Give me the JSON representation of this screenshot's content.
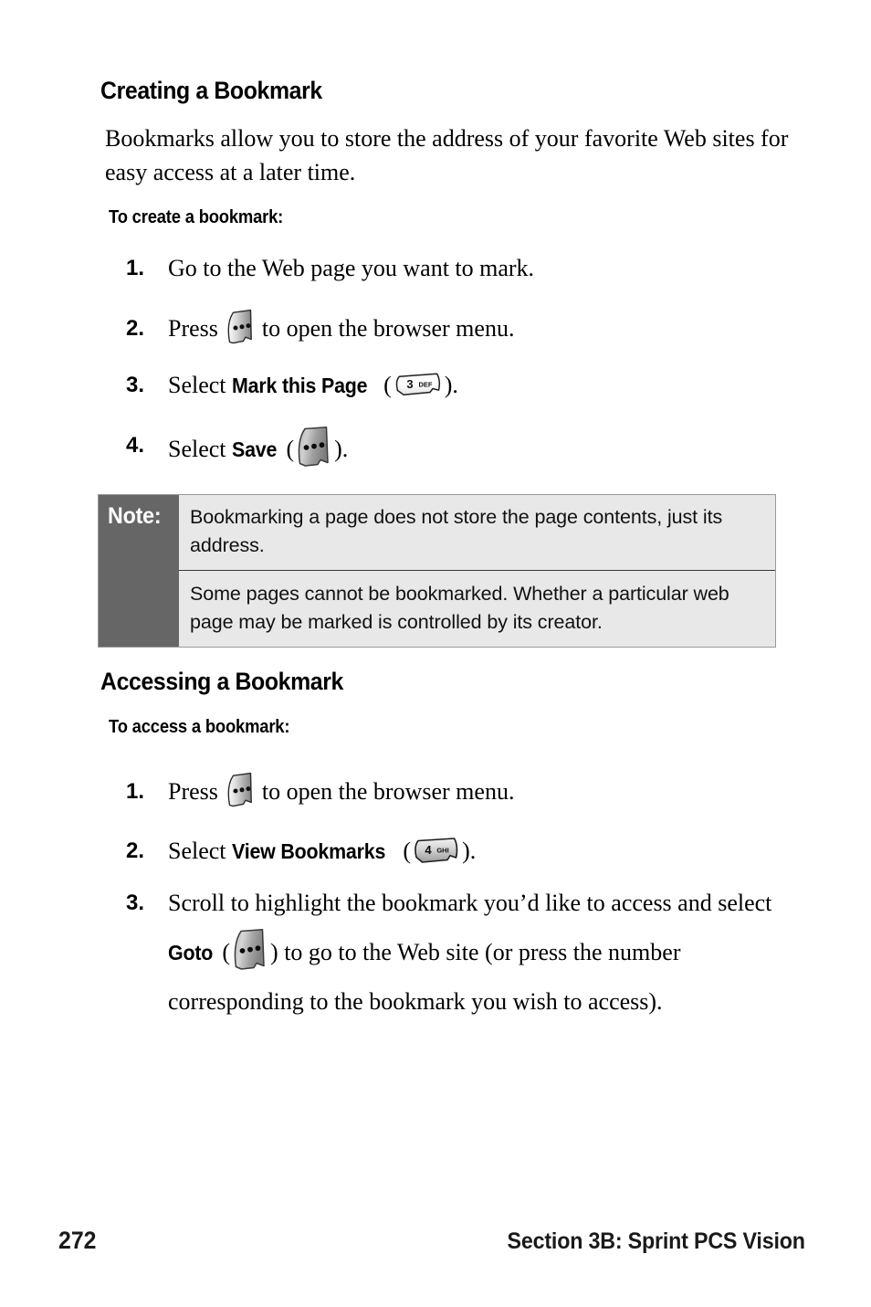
{
  "page": {
    "number": "272",
    "footer_section": "Section 3B: Sprint PCS Vision"
  },
  "sections": [
    {
      "heading": "Creating a Bookmark",
      "intro": "Bookmarks allow you to store the address of your favorite Web sites for easy access at a later time.",
      "sub_heading": "To create a bookmark:",
      "steps": [
        {
          "num": "1.",
          "pre": "Go to the Web page you want to mark.",
          "bold": "",
          "post": "",
          "icon": null
        },
        {
          "num": "2.",
          "pre": "Press ",
          "bold": "",
          "post": " to open the browser menu.",
          "icon": "softkey-menu-icon"
        },
        {
          "num": "3.",
          "pre": "Select ",
          "bold": "Mark this Page",
          "post": ").",
          "mid": " (",
          "icon": "key-3-def-icon"
        },
        {
          "num": "4.",
          "pre": "Select ",
          "bold": "Save",
          "mid": " (",
          "post": ").",
          "icon": "softkey-save-icon"
        }
      ]
    },
    {
      "heading": "Accessing a Bookmark",
      "sub_heading": "To access a bookmark:",
      "steps": [
        {
          "num": "1.",
          "pre": "Press ",
          "bold": "",
          "post": " to open the browser menu.",
          "icon": "softkey-menu-icon"
        },
        {
          "num": "2.",
          "pre": "Select ",
          "bold": "View Bookmarks",
          "mid": " (",
          "post": ").",
          "icon": "key-4-ghi-icon"
        },
        {
          "num": "3.",
          "pre": "Scroll to highlight the bookmark you’d like to access and select ",
          "bold": "Goto",
          "mid": " (",
          "post": ") to go to the Web site (or press the number corresponding to the bookmark you wish to access).",
          "icon": "softkey-goto-icon"
        }
      ]
    }
  ],
  "note_box": {
    "label": "Note:",
    "paragraphs": [
      "Bookmarking a page does not store the page contents, just its address.",
      "Some pages cannot be bookmarked. Whether a particular web page may be marked is controlled by its creator."
    ]
  },
  "keys": {
    "key3": {
      "digit": "3",
      "letters": "DEF"
    },
    "key4": {
      "digit": "4",
      "letters": "GHI"
    }
  },
  "colors": {
    "note_label_bg": "#666666",
    "note_body_bg": "#e8e8e8",
    "note_border": "#9a9a9a",
    "text": "#000000"
  }
}
